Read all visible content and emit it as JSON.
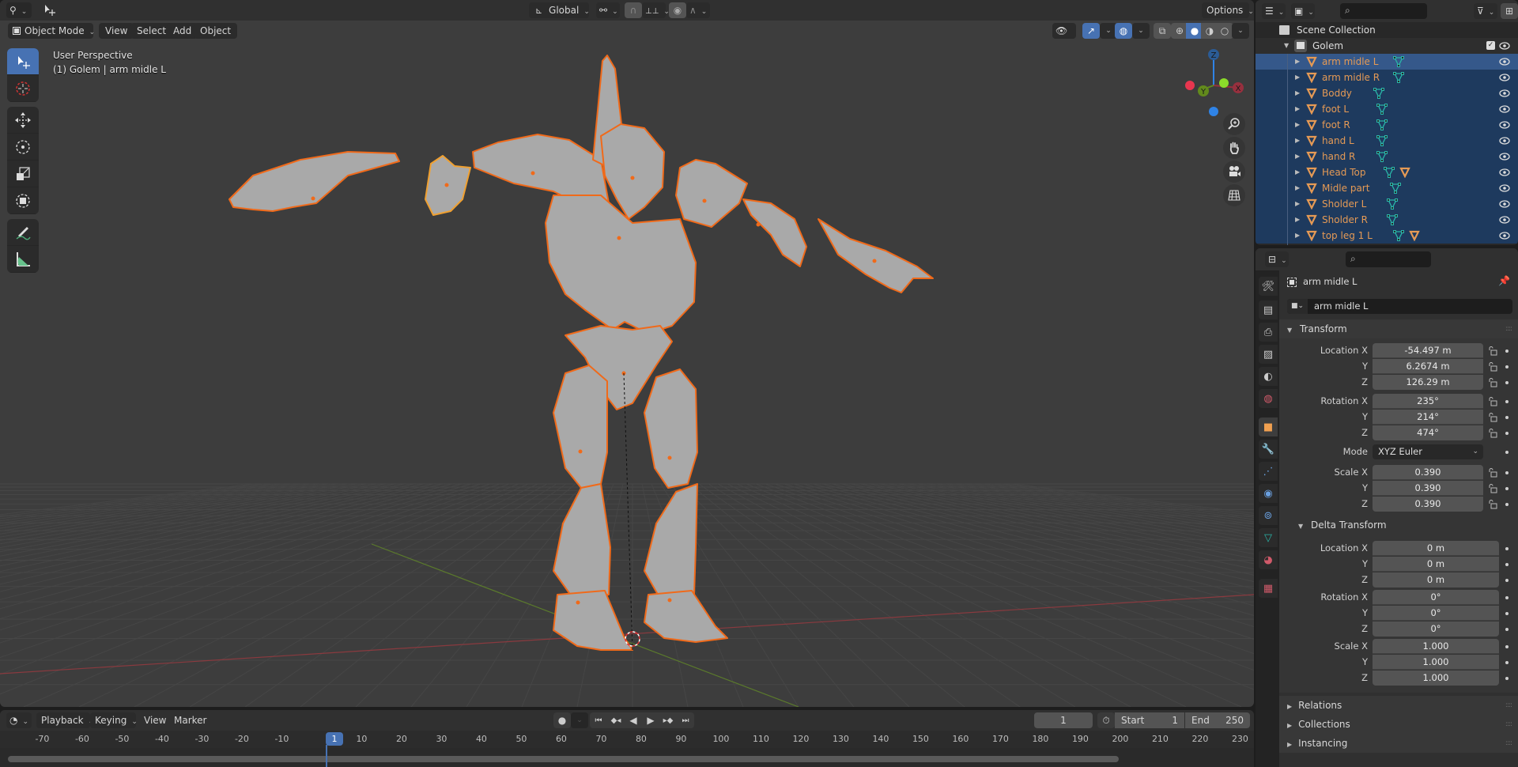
{
  "topbar": {
    "editor_type_icon": "3d-viewport-icon",
    "tool_icon": "select-move-icon",
    "orientation": "Global",
    "pivot_icon": "pivot-link-icon",
    "snap_icon": "magnet-icon",
    "snap_increment_icon": "snap-increment-icon",
    "proportional_icon": "proportional-edit-icon",
    "falloff_icon": "falloff-curve-icon",
    "options_label": "Options"
  },
  "viewport_header": {
    "mode_label": "Object Mode",
    "menus": [
      "View",
      "Select",
      "Add",
      "Object"
    ],
    "shading_modes": [
      "wireframe",
      "solid",
      "material-preview",
      "rendered"
    ],
    "active_shading": "solid"
  },
  "viewport_overlay": {
    "view_name": "User Perspective",
    "context_line": "(1) Golem | arm midle L"
  },
  "gizmo": {
    "axes": [
      "X",
      "Y",
      "Z"
    ],
    "colors": {
      "x": "#e8364f",
      "y": "#8bdb2a",
      "z": "#2f83e6",
      "x_dark": "#97303e",
      "y_dark": "#628a1c",
      "z_dark": "#2b5c96"
    }
  },
  "nav_buttons": [
    "zoom-icon",
    "hand-pan-icon",
    "camera-icon",
    "ortho-grid-icon"
  ],
  "tools": [
    [
      "select-box-icon",
      "cursor-icon"
    ],
    [
      "move-icon",
      "rotate-icon",
      "scale-icon",
      "transform-icon"
    ],
    [
      "annotate-icon",
      "measure-icon"
    ]
  ],
  "scene": {
    "selection_outline_color": "#f06a1a",
    "active_outline_color": "#f0a030",
    "mesh_color": "#a8a8a8"
  },
  "timeline": {
    "editor_icon": "timeline-clock-icon",
    "menus": [
      "Playback",
      "Keying",
      "View",
      "Marker"
    ],
    "current_frame": "1",
    "start_label": "Start",
    "start_value": "1",
    "end_label": "End",
    "end_value": "250",
    "ticks": [
      "-70",
      "-60",
      "-50",
      "-40",
      "-30",
      "-20",
      "-10",
      "1",
      "10",
      "20",
      "30",
      "40",
      "50",
      "60",
      "70",
      "80",
      "90",
      "100",
      "110",
      "120",
      "130",
      "140",
      "150",
      "160",
      "170",
      "180",
      "190",
      "200",
      "210",
      "220",
      "230"
    ]
  },
  "outliner": {
    "search_placeholder": "",
    "root": "Scene Collection",
    "collection": "Golem",
    "items": [
      {
        "name": "arm midle L",
        "extra_icons": [
          "mesh-data-icon"
        ],
        "active": true
      },
      {
        "name": "arm midle R",
        "extra_icons": [
          "mesh-data-icon"
        ]
      },
      {
        "name": "Boddy",
        "extra_icons": [
          "mesh-data-icon"
        ]
      },
      {
        "name": "foot L",
        "extra_icons": [
          "mesh-data-icon"
        ]
      },
      {
        "name": "foot R",
        "extra_icons": [
          "mesh-data-icon"
        ]
      },
      {
        "name": "hand L",
        "extra_icons": [
          "mesh-data-icon"
        ]
      },
      {
        "name": "hand R",
        "extra_icons": [
          "mesh-data-icon"
        ]
      },
      {
        "name": "Head Top",
        "extra_icons": [
          "mesh-data-icon",
          "object-icon"
        ]
      },
      {
        "name": "Midle part",
        "extra_icons": [
          "mesh-data-icon"
        ]
      },
      {
        "name": "Sholder L",
        "extra_icons": [
          "mesh-data-icon"
        ]
      },
      {
        "name": "Sholder R",
        "extra_icons": [
          "mesh-data-icon"
        ]
      },
      {
        "name": "top leg 1 L",
        "extra_icons": [
          "mesh-data-icon",
          "object-icon"
        ]
      }
    ]
  },
  "properties": {
    "search_placeholder": "",
    "object_title": "arm midle L",
    "object_name_field": "arm midle L",
    "tabs": [
      "tool-icon",
      "render-icon",
      "output-icon",
      "view-layer-icon",
      "scene-icon",
      "world-icon",
      "object-icon",
      "modifier-icon",
      "particles-icon",
      "physics-icon",
      "constraints-icon",
      "mesh-data-icon",
      "material-icon",
      "texture-icon"
    ],
    "active_tab": "object-icon",
    "transform": {
      "title": "Transform",
      "location_label": "Location X",
      "location": [
        "-54.497 m",
        "6.2674 m",
        "126.29 m"
      ],
      "rotation_label": "Rotation X",
      "rotation": [
        "235°",
        "214°",
        "474°"
      ],
      "mode_label": "Mode",
      "mode_value": "XYZ Euler",
      "scale_label": "Scale X",
      "scale": [
        "0.390",
        "0.390",
        "0.390"
      ],
      "axis_y": "Y",
      "axis_z": "Z"
    },
    "delta_transform": {
      "title": "Delta Transform",
      "location": [
        "0 m",
        "0 m",
        "0 m"
      ],
      "rotation": [
        "0°",
        "0°",
        "0°"
      ],
      "scale": [
        "1.000",
        "1.000",
        "1.000"
      ]
    },
    "collapsed_panels": [
      "Relations",
      "Collections",
      "Instancing"
    ]
  }
}
